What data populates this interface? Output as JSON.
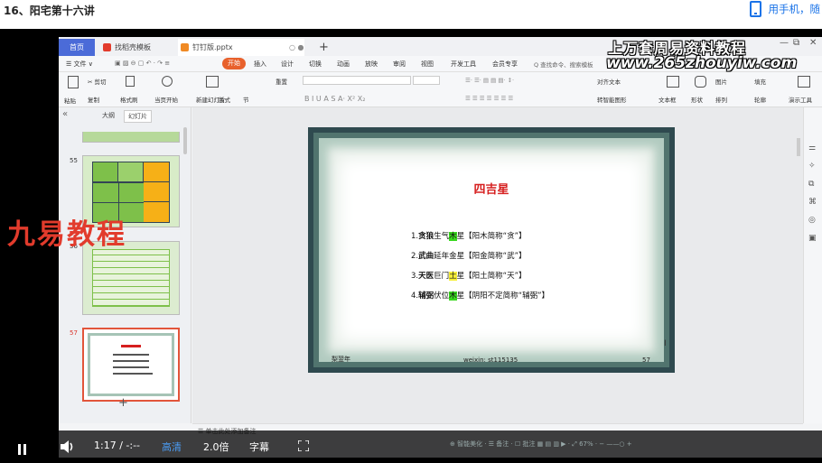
{
  "page": {
    "lesson_title": "16、阳宅第十六讲",
    "mobile_hint": "用手机，随"
  },
  "wps": {
    "tabs": {
      "home": "首页",
      "template": "找稻壳模板",
      "file": "钉钉版.pptx",
      "close": "○ ●",
      "new_tab": "+"
    },
    "watermark_top": "上万套周易资料教程",
    "watermark_url": "www.265zhouyiw.com",
    "window_controls": {
      "min": "—",
      "max": "⧉",
      "close": "✕"
    },
    "menu": [
      "☰ 文件 ∨",
      "插入",
      "设计",
      "切换",
      "动画",
      "放映",
      "审阅",
      "视图",
      "开发工具",
      "会员专享"
    ],
    "menu_start": "开始",
    "menu_search": "Q 查找命令、搜索模板",
    "ribbon": {
      "paste": "粘贴",
      "cut": "✂ 剪切",
      "copy": "复制",
      "format_painter": "格式刷",
      "from_start": "当页开始",
      "new_slide": "新建幻灯片",
      "layout": "版式",
      "section": "节",
      "reset": "重置",
      "font_buttons": "B I U A S A· X² X₂",
      "text_box": "文本框",
      "shape": "形状",
      "arrange": "排列",
      "picture": "图片",
      "fill": "填充",
      "outline": "轮廓",
      "presentation_tools": "演示工具",
      "align_text": "对齐文本",
      "convert_smartart": "转智能图形"
    },
    "left_panel": {
      "collapse": "«",
      "outline_tab": "大纲",
      "slides_tab": "幻灯片",
      "slide_numbers": [
        "55",
        "56",
        "57"
      ],
      "add_slide": "+"
    },
    "slide": {
      "title": "四吉星",
      "lines": [
        {
          "num": "1.",
          "a": "贪狼",
          "b": "生气",
          "hl": "木",
          "c": "星【阳木简称“贪”】"
        },
        {
          "num": "2.",
          "a": "武曲",
          "b": "延年",
          "hl": "金",
          "c": "星【阳金简称“武”】"
        },
        {
          "num": "3.",
          "a": "天医",
          "b": "巨门",
          "hl": "土",
          "c": "星【阳土简称“天”】"
        },
        {
          "num": "4.",
          "a": "辅弼",
          "b": "伏位",
          "hl": "木",
          "c": "星【阴阳不定简称“辅弼”】"
        }
      ],
      "footer_left": "梨翌年",
      "footer_center": "weixin: st115135",
      "footer_right": "57"
    },
    "notes": "☰ 单击此处添加备注",
    "status_right": "⊕ 智能美化 ·  ☰ 备注 ·  ☐ 批注   ▦ ▤ ▥   ▶ ·  ⤢ 67% ·  −  ——○  +"
  },
  "overlay": {
    "jiuyi": "九易教程"
  },
  "player": {
    "time": "1:17 / -:--",
    "quality": "高清",
    "speed": "2.0倍",
    "subtitle": "字幕"
  },
  "colors": {
    "accent_blue": "#1a73e8",
    "wps_blue": "#4b6bd8",
    "title_red": "#d61f1f",
    "highlight_green": "#39d81f",
    "highlight_yellow": "#f7ef3a",
    "start_orange": "#e8612c"
  }
}
